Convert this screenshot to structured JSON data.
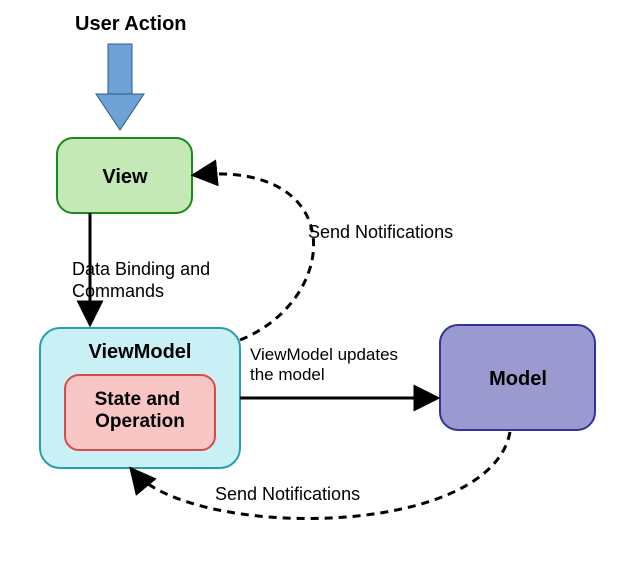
{
  "title": "User Action",
  "nodes": {
    "view": {
      "label": "View",
      "fill": "#c5e8b7",
      "stroke": "#1b8a1b"
    },
    "viewmodel": {
      "label": "ViewModel",
      "fill": "#c9f0f5",
      "stroke": "#2b9db0"
    },
    "state_op": {
      "label": "State and\nOperation",
      "fill": "#f7c6c5",
      "stroke": "#d94a4a"
    },
    "model": {
      "label": "Model",
      "fill": "#9a9ad1",
      "stroke": "#333399"
    }
  },
  "edges": {
    "user_to_view": {
      "label": ""
    },
    "view_to_vm": {
      "label": "Data Binding and\nCommands"
    },
    "vm_to_model": {
      "label": "ViewModel updates\nthe model"
    },
    "vm_to_view_notify": {
      "label": "Send Notifications"
    },
    "model_to_vm_notify": {
      "label": "Send Notifications"
    }
  }
}
